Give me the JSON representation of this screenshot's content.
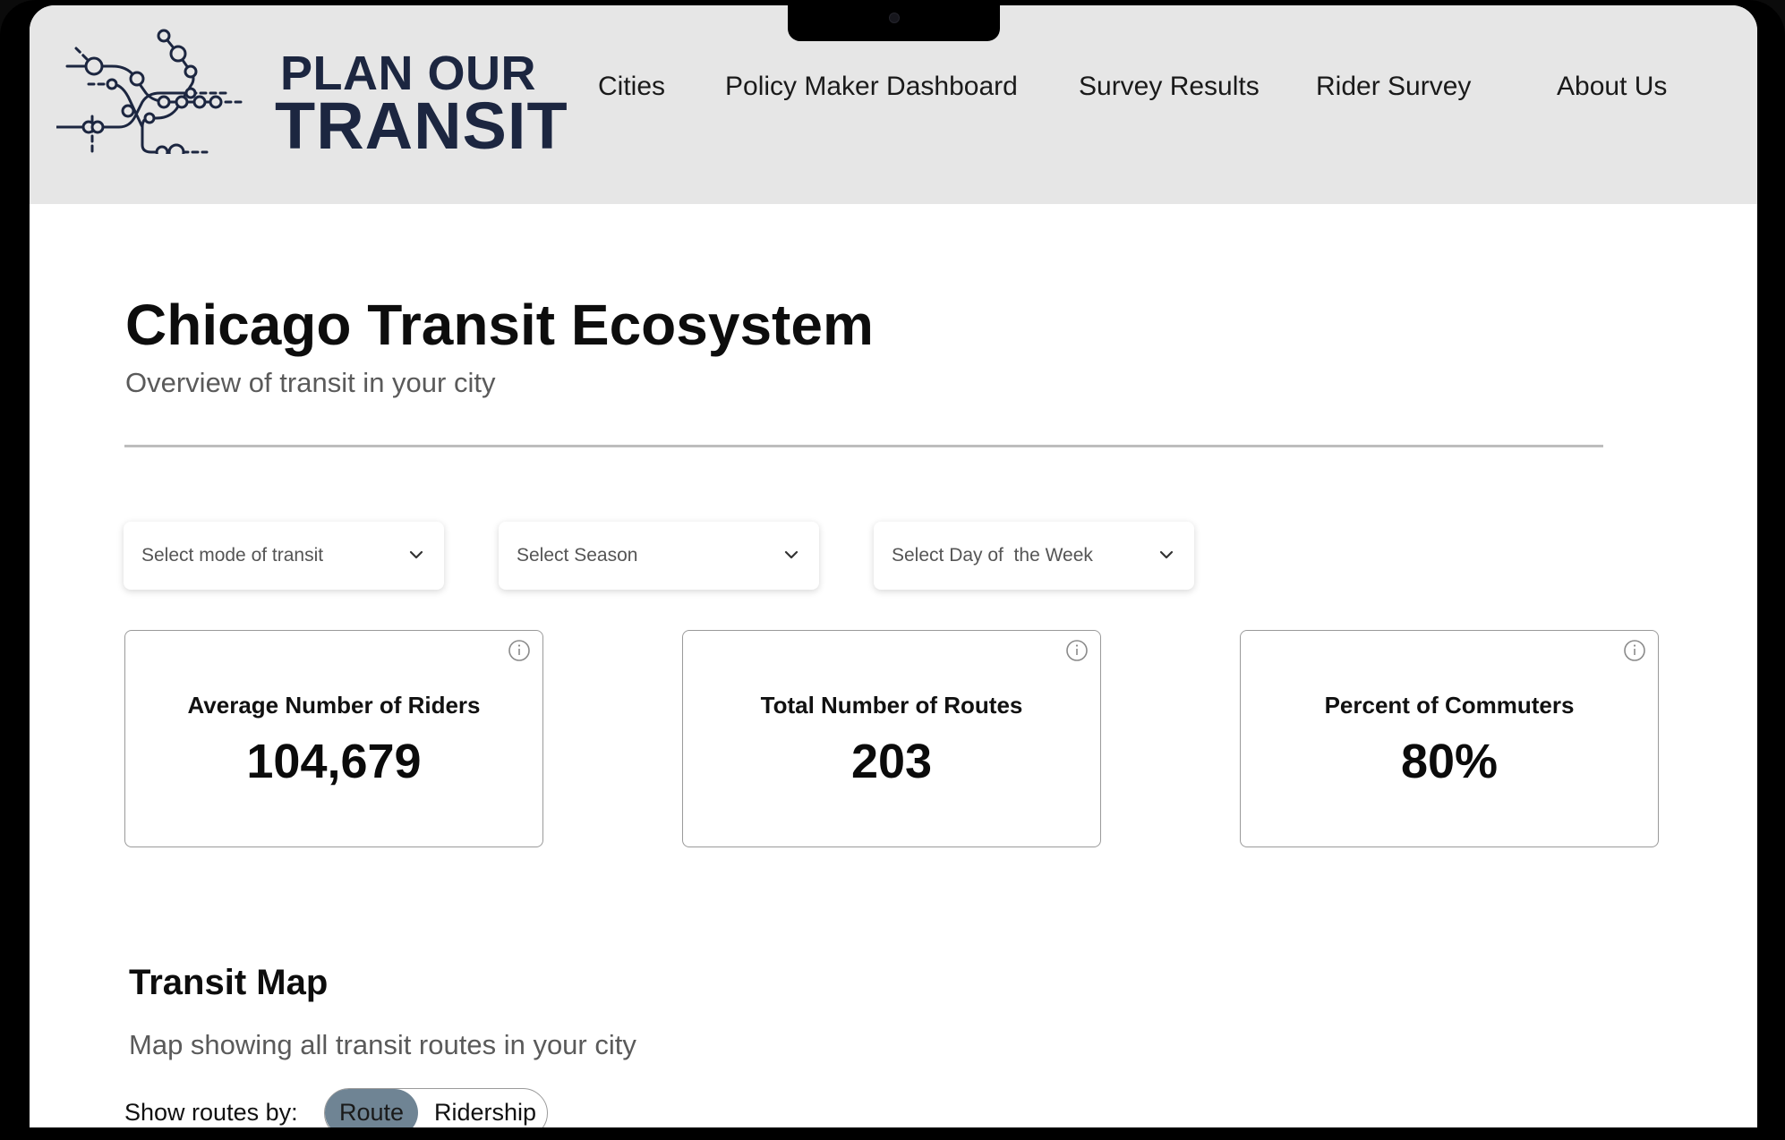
{
  "brand": {
    "line1": "PLAN OUR",
    "line2": "TRANSIT",
    "color": "#1c2640"
  },
  "nav": {
    "items": [
      {
        "label": "Cities"
      },
      {
        "label": "Policy Maker Dashboard"
      },
      {
        "label": "Survey Results"
      },
      {
        "label": "Rider Survey"
      },
      {
        "label": "About Us"
      }
    ]
  },
  "page": {
    "title": "Chicago Transit Ecosystem",
    "subtitle": "Overview of transit in your city"
  },
  "filters": [
    {
      "placeholder": "Select mode of transit",
      "icon": "chevron-down-icon"
    },
    {
      "placeholder": "Select Season",
      "icon": "chevron-down-icon"
    },
    {
      "placeholder": "Select Day of  the Week",
      "icon": "chevron-down-icon"
    }
  ],
  "metrics": [
    {
      "label": "Average Number of Riders",
      "value": "104,679",
      "icon": "info-icon"
    },
    {
      "label": "Total Number of Routes",
      "value": "203",
      "icon": "info-icon"
    },
    {
      "label": "Percent of Commuters",
      "value": "80%",
      "icon": "info-icon"
    }
  ],
  "map_section": {
    "title": "Transit Map",
    "subtitle": "Map showing all transit routes in your city",
    "toggle_label": "Show routes by:",
    "options": [
      {
        "label": "Route",
        "selected": true
      },
      {
        "label": "Ridership",
        "selected": false
      }
    ],
    "active_color": "#6f8494"
  },
  "colors": {
    "header_bg": "#e6e6e6",
    "page_bg": "#ffffff",
    "bezel": "#000000"
  }
}
